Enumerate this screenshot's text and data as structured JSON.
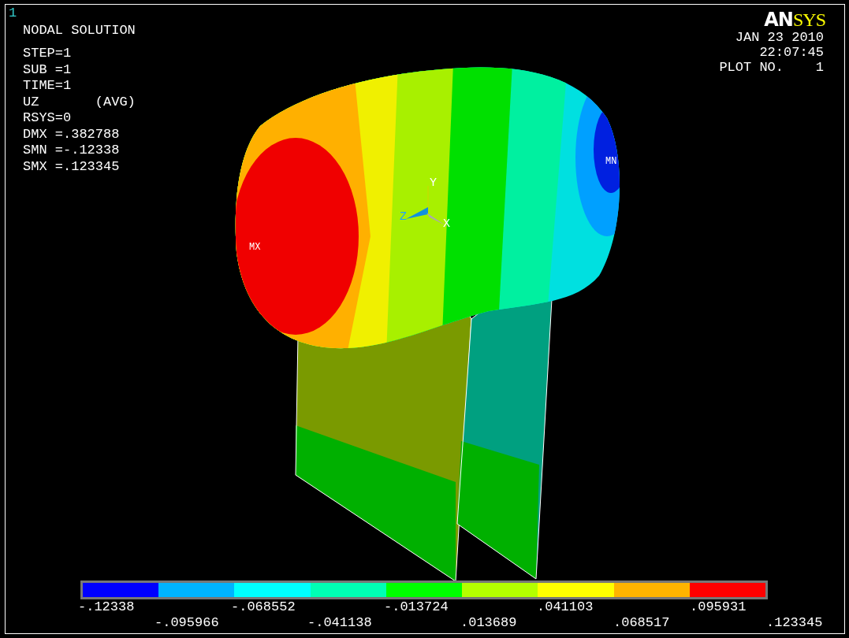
{
  "plot_number_corner": "1",
  "title": "NODAL SOLUTION",
  "info_lines": [
    "STEP=1",
    "SUB =1",
    "TIME=1",
    "UZ       (AVG)",
    "RSYS=0",
    "DMX =.382788",
    "SMN =-.12338",
    "SMX =.123345"
  ],
  "logo": {
    "main": "AN",
    "accent": "SYS"
  },
  "date": "JAN 23 2010",
  "time": "22:07:45",
  "plot_label": "PLOT NO.    1",
  "model": {
    "max_label": "MX",
    "min_label": "MN",
    "triad": {
      "x": "X",
      "y": "Y",
      "z": "Z"
    }
  },
  "legend": {
    "bands": [
      {
        "color": "#0000ff"
      },
      {
        "color": "#00b4ff"
      },
      {
        "color": "#00ffff"
      },
      {
        "color": "#00ffb4"
      },
      {
        "color": "#00ff00"
      },
      {
        "color": "#b4ff00"
      },
      {
        "color": "#ffff00"
      },
      {
        "color": "#ffb400"
      },
      {
        "color": "#ff0000"
      }
    ],
    "ticks": [
      "-.12338",
      "-.095966",
      "-.068552",
      "-.041138",
      "-.013724",
      ".013689",
      ".041103",
      ".068517",
      ".095931",
      ".123345"
    ]
  }
}
